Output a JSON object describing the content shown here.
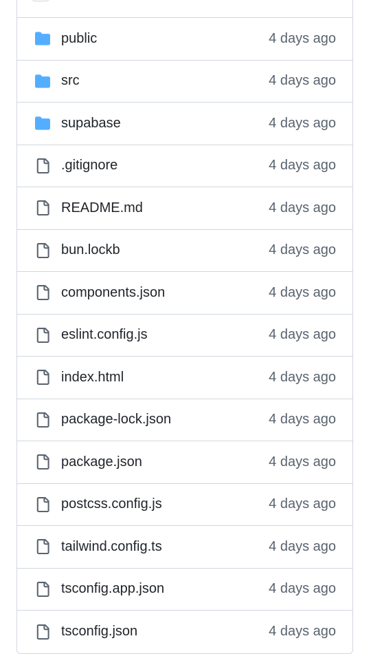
{
  "files": [
    {
      "name": "public",
      "type": "folder",
      "icon": "folder-icon",
      "date": "4 days ago"
    },
    {
      "name": "src",
      "type": "folder",
      "icon": "folder-icon",
      "date": "4 days ago"
    },
    {
      "name": "supabase",
      "type": "folder",
      "icon": "folder-icon",
      "date": "4 days ago"
    },
    {
      "name": ".gitignore",
      "type": "file",
      "icon": "file-icon",
      "date": "4 days ago"
    },
    {
      "name": "README.md",
      "type": "file",
      "icon": "file-icon",
      "date": "4 days ago"
    },
    {
      "name": "bun.lockb",
      "type": "file",
      "icon": "file-icon",
      "date": "4 days ago"
    },
    {
      "name": "components.json",
      "type": "file",
      "icon": "file-icon",
      "date": "4 days ago"
    },
    {
      "name": "eslint.config.js",
      "type": "file",
      "icon": "file-icon",
      "date": "4 days ago"
    },
    {
      "name": "index.html",
      "type": "file",
      "icon": "file-icon",
      "date": "4 days ago"
    },
    {
      "name": "package-lock.json",
      "type": "file",
      "icon": "file-icon",
      "date": "4 days ago"
    },
    {
      "name": "package.json",
      "type": "file",
      "icon": "file-icon",
      "date": "4 days ago"
    },
    {
      "name": "postcss.config.js",
      "type": "file",
      "icon": "file-icon",
      "date": "4 days ago"
    },
    {
      "name": "tailwind.config.ts",
      "type": "file",
      "icon": "file-icon",
      "date": "4 days ago"
    },
    {
      "name": "tsconfig.app.json",
      "type": "file",
      "icon": "file-icon",
      "date": "4 days ago"
    },
    {
      "name": "tsconfig.json",
      "type": "file",
      "icon": "file-icon",
      "date": "4 days ago"
    }
  ],
  "colors": {
    "folder": "#54aeff",
    "file_icon": "#59636e",
    "text": "#1f2328",
    "muted": "#59636e",
    "border": "#d0d7de"
  }
}
